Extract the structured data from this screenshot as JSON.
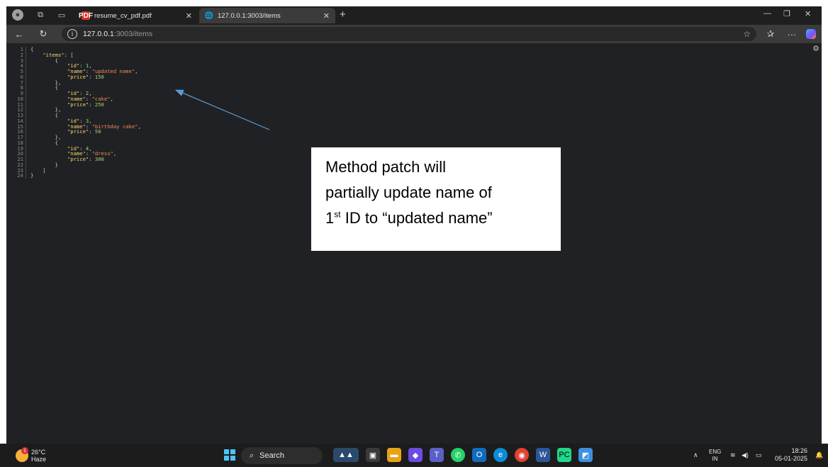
{
  "browser": {
    "tabs": [
      {
        "title": "resume_cv_pdf.pdf",
        "active": false
      },
      {
        "title": "127.0.0.1:3003/items",
        "active": true
      }
    ],
    "address": {
      "host": "127.0.0.1",
      "path": ":3003/items"
    }
  },
  "json_viewer": {
    "line_numbers": [
      "1",
      "2",
      "3",
      "4",
      "5",
      "6",
      "7",
      "8",
      "9",
      "10",
      "11",
      "12",
      "13",
      "14",
      "15",
      "16",
      "17",
      "18",
      "19",
      "20",
      "21",
      "22",
      "23",
      "24"
    ],
    "items": [
      {
        "id": "1",
        "name": "\"updated name\"",
        "price": "150"
      },
      {
        "id": "2",
        "name": "\"cake\"",
        "price": "250"
      },
      {
        "id": "3",
        "name": "\"birthday cake\"",
        "price": "50"
      },
      {
        "id": "4",
        "name": "\"dress\"",
        "price": "300"
      }
    ],
    "items_key": "\"items\"",
    "id_key": "\"id\"",
    "name_key": "\"name\"",
    "price_key": "\"price\""
  },
  "annotation": {
    "line1": "Method patch will",
    "line2": "partially update name of",
    "line3_num": "1",
    "line3_sup": "st",
    "line3_rest": " ID to “updated name”"
  },
  "taskbar": {
    "temperature": "26°C",
    "weather": "Haze",
    "weather_badge": "1",
    "search_label": "Search",
    "language_top": "ENG",
    "language_bottom": "IN",
    "time": "18:26",
    "date": "05-01-2025"
  },
  "colors": {
    "json_key": "#f5d66b",
    "json_string": "#f28b54",
    "json_number": "#a5d66b",
    "arrow": "#5b9bd5"
  }
}
